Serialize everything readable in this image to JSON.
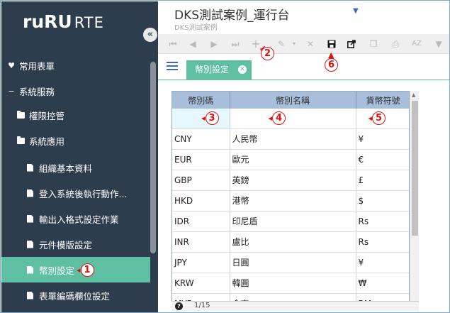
{
  "app": {
    "logo_main": "ruRU",
    "logo_suffix": "RTE",
    "title": "DKS測試案例_運行台",
    "subtitle": "DKS測試案例"
  },
  "sidebar": {
    "collapse_glyph": "«",
    "items": [
      {
        "label": "常用表單",
        "icon": "heart-icon"
      },
      {
        "label": "系統服務",
        "icon": "minus-icon"
      },
      {
        "label": "權限控管",
        "icon": "folder-icon"
      },
      {
        "label": "系統應用",
        "icon": "folder-icon"
      },
      {
        "label": "組織基本資料",
        "icon": "file-icon"
      },
      {
        "label": "登入系統後執行動作...",
        "icon": "file-icon"
      },
      {
        "label": "輸出入格式設定作業",
        "icon": "file-icon"
      },
      {
        "label": "元件模版設定",
        "icon": "file-icon"
      },
      {
        "label": "幣別設定",
        "icon": "file-icon",
        "active": true
      },
      {
        "label": "表單編碼欄位設定",
        "icon": "file-icon"
      }
    ]
  },
  "toolbar": {
    "icons": [
      "first-page-icon",
      "prev-page-icon",
      "next-page-icon",
      "last-page-icon",
      "add-icon",
      "edit-icon",
      "delete-icon",
      "save-icon",
      "export-icon",
      "copy-icon",
      "print-icon",
      "sort-icon",
      "filter-icon"
    ]
  },
  "tabs": [
    {
      "label": "幣別設定",
      "active": true
    }
  ],
  "grid": {
    "columns": [
      "幣別碼",
      "幣別名稱",
      "貨幣符號"
    ],
    "rows": [
      [
        "CNY",
        "人民幣",
        "¥"
      ],
      [
        "EUR",
        "歐元",
        "€"
      ],
      [
        "GBP",
        "英鎊",
        "£"
      ],
      [
        "HKD",
        "港幣",
        "$"
      ],
      [
        "IDR",
        "印尼盾",
        "Rs"
      ],
      [
        "INR",
        "盧比",
        "Rs"
      ],
      [
        "JPY",
        "日圓",
        "¥"
      ],
      [
        "KRW",
        "韓圓",
        "₩"
      ],
      [
        "MYR",
        "令吉",
        "RM"
      ]
    ],
    "pager": "1/15"
  },
  "annotations": {
    "m1": "1",
    "m2": "2",
    "m3": "3",
    "m4": "4",
    "m5": "5",
    "m6": "6",
    "color": "#e01010"
  },
  "colors": {
    "sidebar_bg": "#2d3d4d",
    "accent": "#5fbfa3",
    "grid_header": "#a8bfdc"
  }
}
